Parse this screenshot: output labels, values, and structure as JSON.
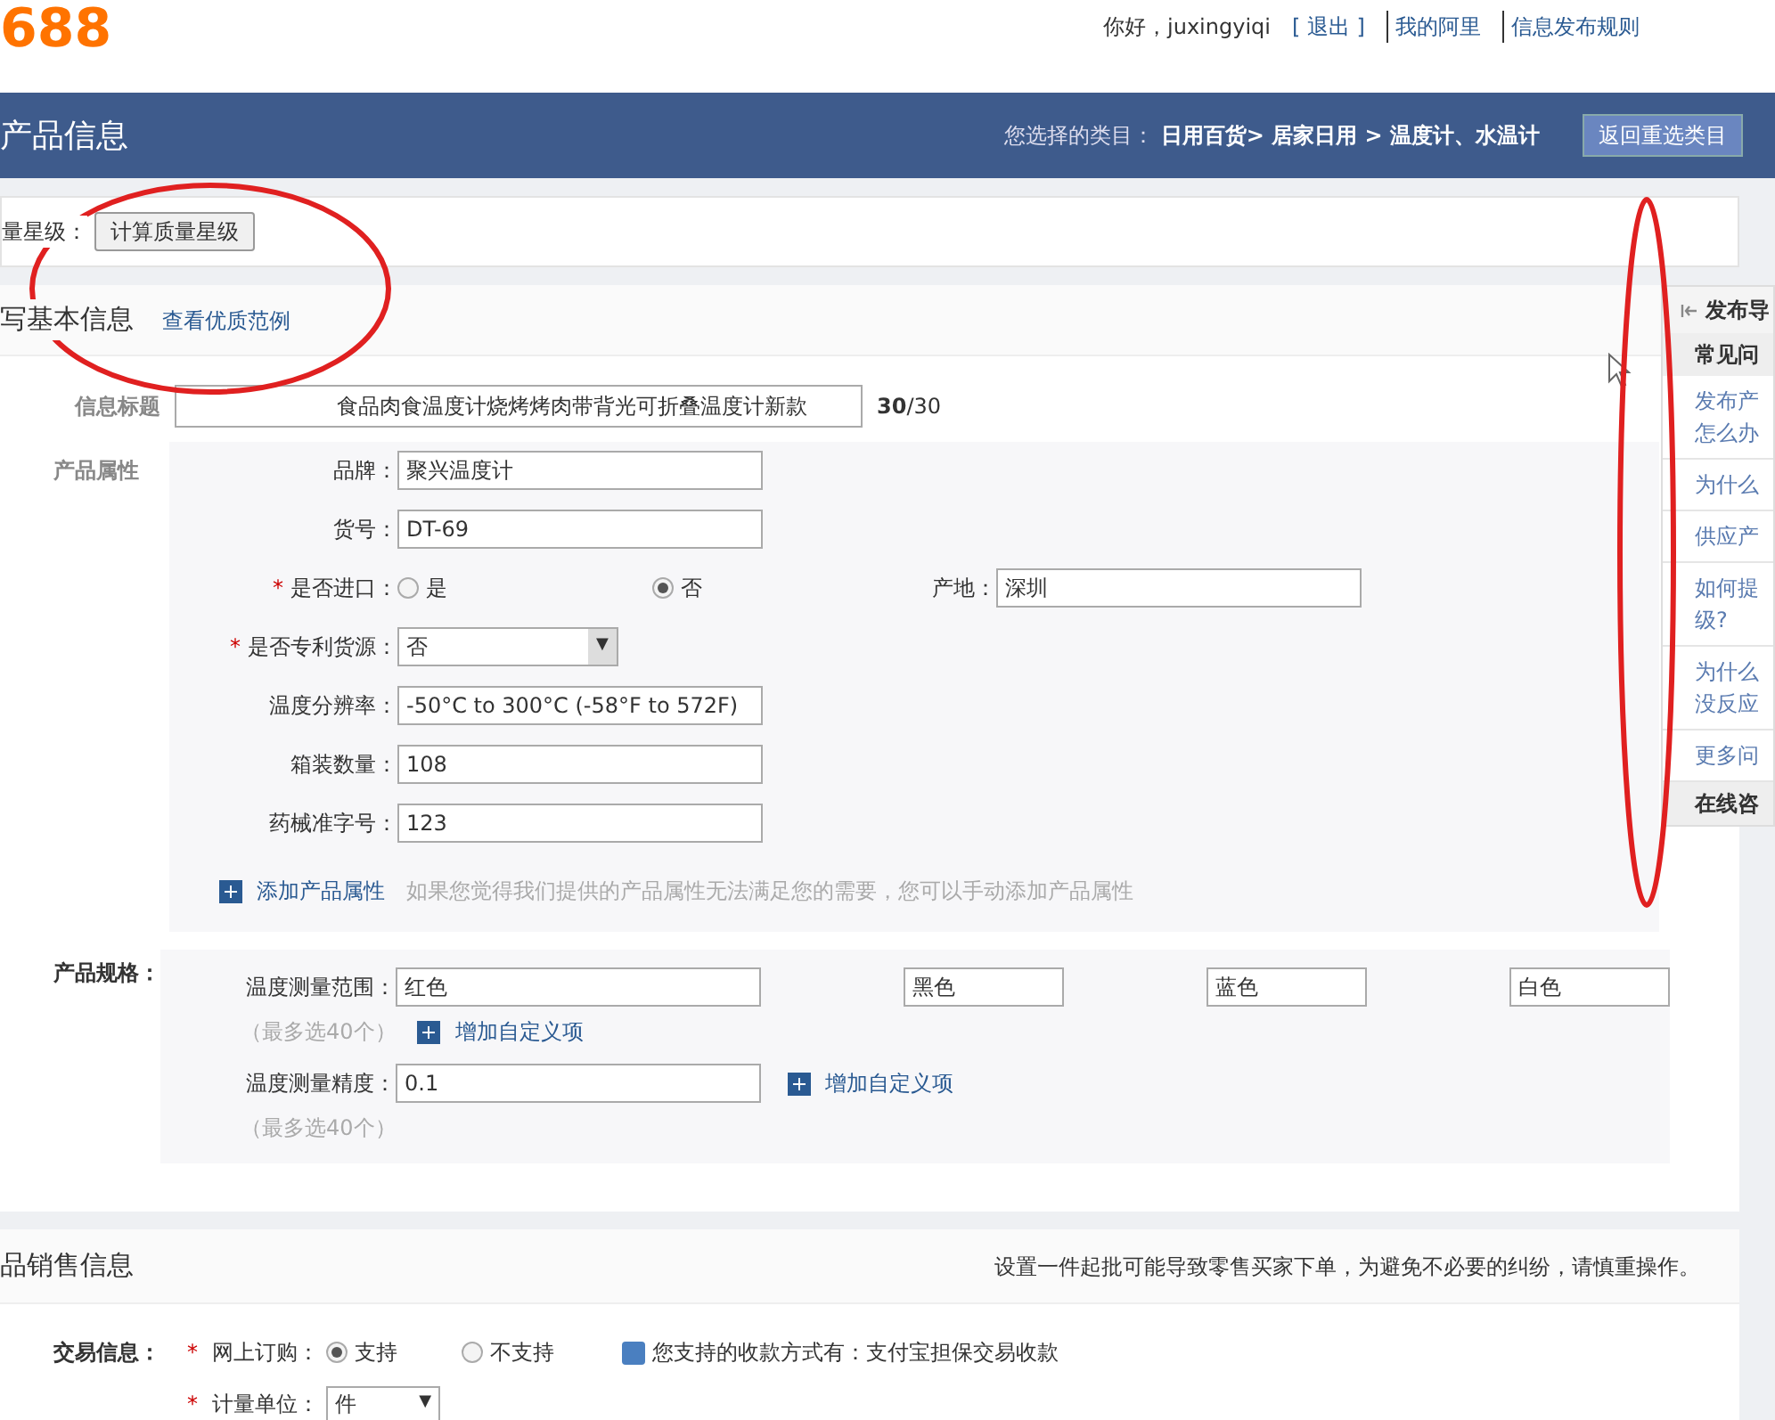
{
  "header": {
    "logo": "688",
    "greeting": "你好，juxingyiqi",
    "links": [
      "[ 退出 ]",
      "我的阿里",
      "信息发布规则"
    ]
  },
  "title_bar": {
    "title": "产品信息",
    "category_label": "您选择的类目：",
    "category": "日用百货> 居家日用 > 温度计、水温计",
    "button": "返回重选类目"
  },
  "quality": {
    "label": "量星级：",
    "button": "计算质量星级"
  },
  "basic_info": {
    "heading": "写基本信息",
    "link": "查看优质范例",
    "title_label": "信息标题",
    "title_value": "食品肉食温度计烧烤烤肉带背光可折叠温度计新款",
    "title_count": "30",
    "title_max": "/30",
    "attributes_label": "产品属性",
    "attributes": [
      {
        "kind": "text",
        "label": "品牌：",
        "value": "聚兴温度计"
      },
      {
        "kind": "text",
        "label": "货号：",
        "value": "DT-69"
      },
      {
        "kind": "radio",
        "label": "是否进口：",
        "required_mark": "*",
        "options": [
          {
            "label": "是",
            "selected": false
          },
          {
            "label": "否",
            "selected": true
          }
        ],
        "extra_label": "产地：",
        "extra_value": "深圳"
      },
      {
        "kind": "select",
        "label": "是否专利货源：",
        "required_mark": "*",
        "value": "否",
        "caret": "▼"
      },
      {
        "kind": "text",
        "label": "温度分辨率：",
        "value": "-50°C to 300°C (-58°F to 572F)"
      },
      {
        "kind": "text",
        "label": "箱装数量：",
        "value": "108"
      },
      {
        "kind": "text",
        "label": "药械准字号：",
        "value": "123"
      }
    ],
    "add_link": "添加产品属性",
    "add_hint": "如果您觉得我们提供的产品属性无法满足您的需要，您可以手动添加产品属性"
  },
  "specs": {
    "label": "产品规格：",
    "groups": [
      {
        "kind": "multi",
        "label": "温度测量范围：",
        "values": [
          "红色",
          "黑色",
          "蓝色",
          "白色"
        ],
        "note": "（最多选40个）",
        "add": "增加自定义项"
      },
      {
        "kind": "single",
        "label": "温度测量精度：",
        "values": [
          "0.1"
        ],
        "note": "（最多选40个）",
        "add": "增加自定义项"
      }
    ]
  },
  "sales": {
    "heading": "品销售信息",
    "notice": "设置一件起批可能导致零售买家下单，为避免不必要的纠纷，请慎重操作。",
    "trade_label": "交易信息：",
    "online_label": "网上订购：",
    "online_required_mark": "*",
    "options": [
      {
        "label": "支持",
        "selected": true
      },
      {
        "label": "不支持",
        "selected": false
      }
    ],
    "payment_note": "您支持的收款方式有：支付宝担保交易收款",
    "unit_label": "计量单位：",
    "unit_required_mark": "*",
    "unit_value": "件",
    "unit_caret": "▼"
  },
  "sidebar": {
    "title": "发布导",
    "heading": "常见问",
    "items": [
      "发布产怎么办",
      "为什么",
      "供应产",
      "如何提级?",
      "为什么没反应",
      "更多问"
    ],
    "footer": "在线咨"
  }
}
